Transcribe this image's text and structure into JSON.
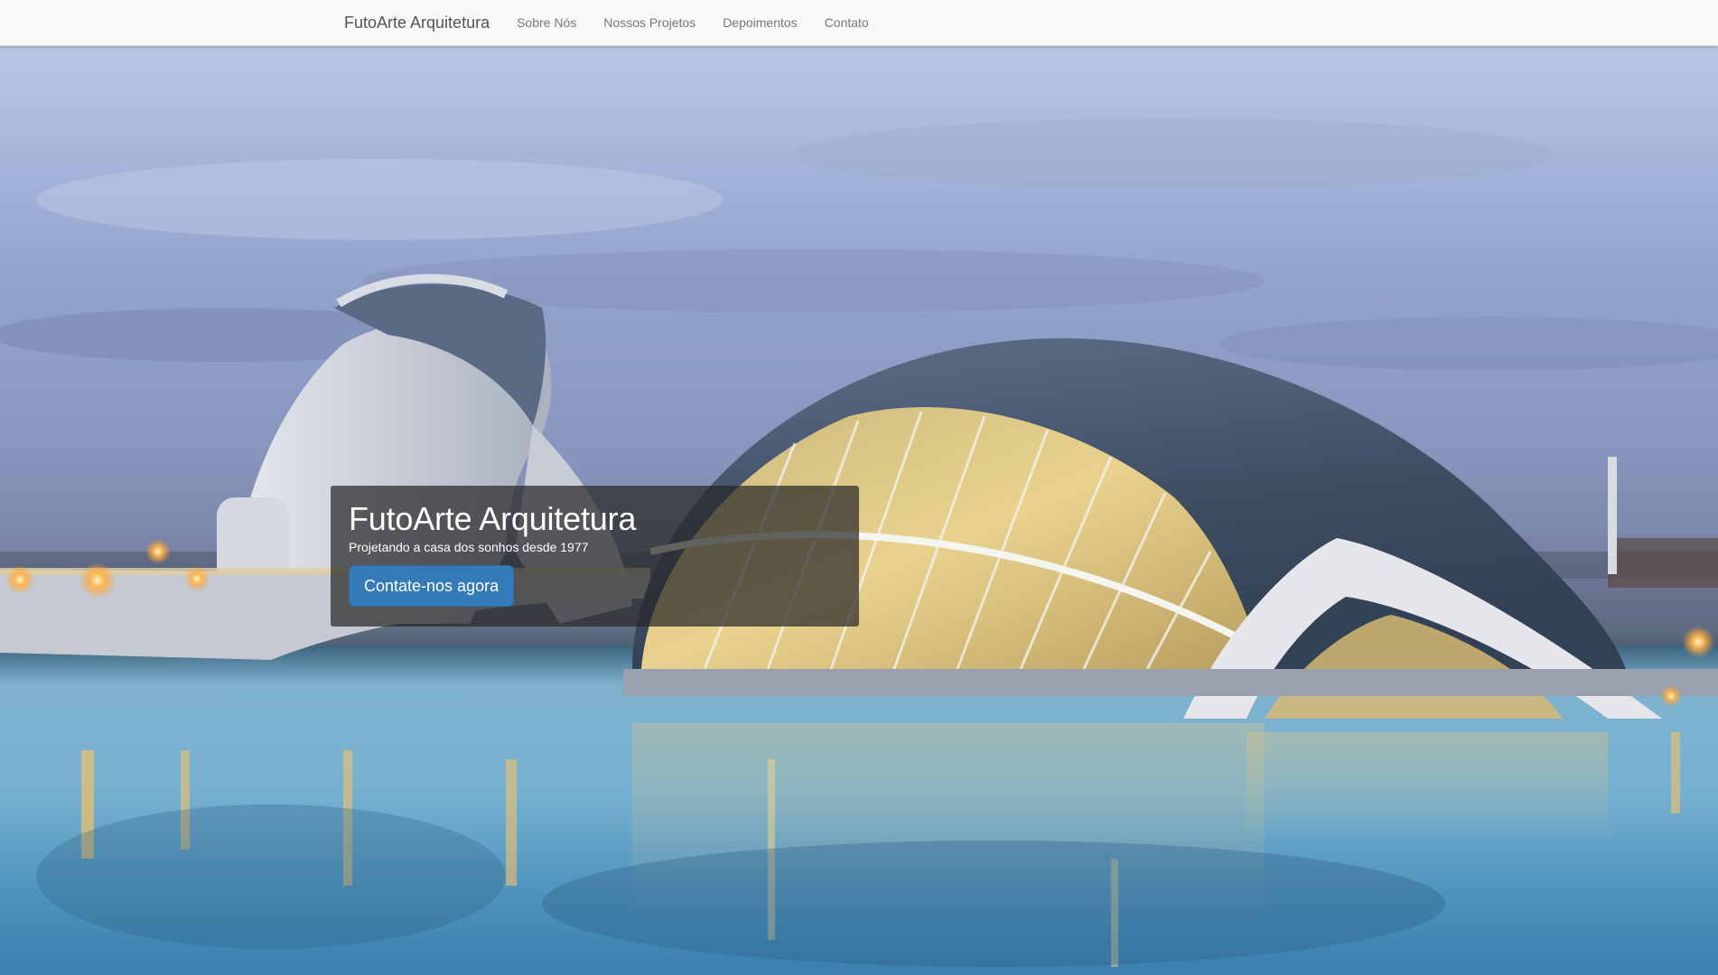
{
  "navbar": {
    "brand": "FutoArte Arquitetura",
    "links": [
      {
        "label": "Sobre Nós"
      },
      {
        "label": "Nossos Projetos"
      },
      {
        "label": "Depoimentos"
      },
      {
        "label": "Contato"
      }
    ]
  },
  "hero": {
    "title": "FutoArte Arquitetura",
    "subtitle": "Projetando a casa dos sonhos desde 1977",
    "cta_label": "Contate-nos agora",
    "background_image": "city-of-arts-and-sciences-dusk-photo"
  },
  "colors": {
    "navbar_bg": "#f8f8f8",
    "brand_text": "#555555",
    "nav_link": "#777777",
    "caption_bg": "rgba(40,40,40,0.72)",
    "cta_bg": "#337ab7"
  }
}
